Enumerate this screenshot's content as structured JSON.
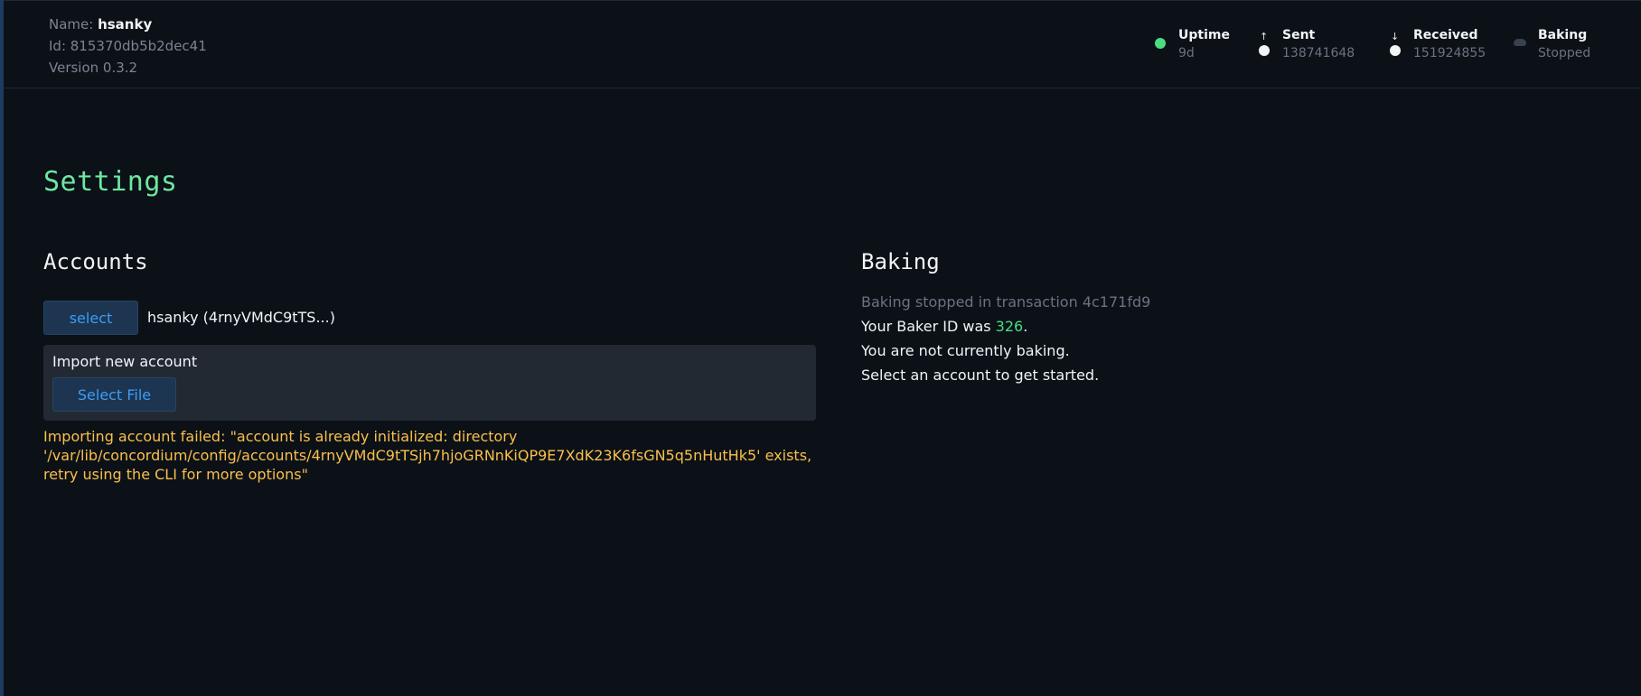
{
  "node": {
    "name_label": "Name: ",
    "name_value": "hsanky",
    "id_text": "Id: 815370db5b2dec41",
    "version_text": "Version 0.3.2"
  },
  "stats": {
    "uptime": {
      "label": "Uptime",
      "value": "9d",
      "icon": "green-status-dot"
    },
    "sent": {
      "label": "Sent",
      "value": "138741648",
      "icon": "arrow-up-dot",
      "arrow": "↑"
    },
    "received": {
      "label": "Received",
      "value": "151924855",
      "icon": "arrow-down-dot",
      "arrow": "↓"
    },
    "baking": {
      "label": "Baking",
      "value": "Stopped",
      "icon": "cloud-icon"
    }
  },
  "page": {
    "title": "Settings"
  },
  "accounts": {
    "title": "Accounts",
    "select_label": "select",
    "selected_account": "hsanky (4rnyVMdC9tTS...)",
    "import_title": "Import new account",
    "select_file_label": "Select File",
    "error_message": "Importing account failed: \"account is already initialized: directory '/var/lib/concordium/config/accounts/4rnyVMdC9tTSjh7hjoGRNnKiQP9E7XdK23K6fsGN5q5nHutHk5' exists, retry using the CLI for more options\""
  },
  "baking": {
    "title": "Baking",
    "status_line": "Baking stopped in transaction 4c171fd9",
    "baker_id_prefix": "Your Baker ID was ",
    "baker_id": "326",
    "baker_id_suffix": ".",
    "not_baking": "You are not currently baking.",
    "get_started": "Select an account to get started."
  },
  "colors": {
    "background": "#0b1117",
    "accent_green": "#4ade80",
    "title_green": "#6ee7a2",
    "link_blue": "#3b9cf7",
    "warning_yellow": "#fbbf4b",
    "panel": "#222933"
  }
}
